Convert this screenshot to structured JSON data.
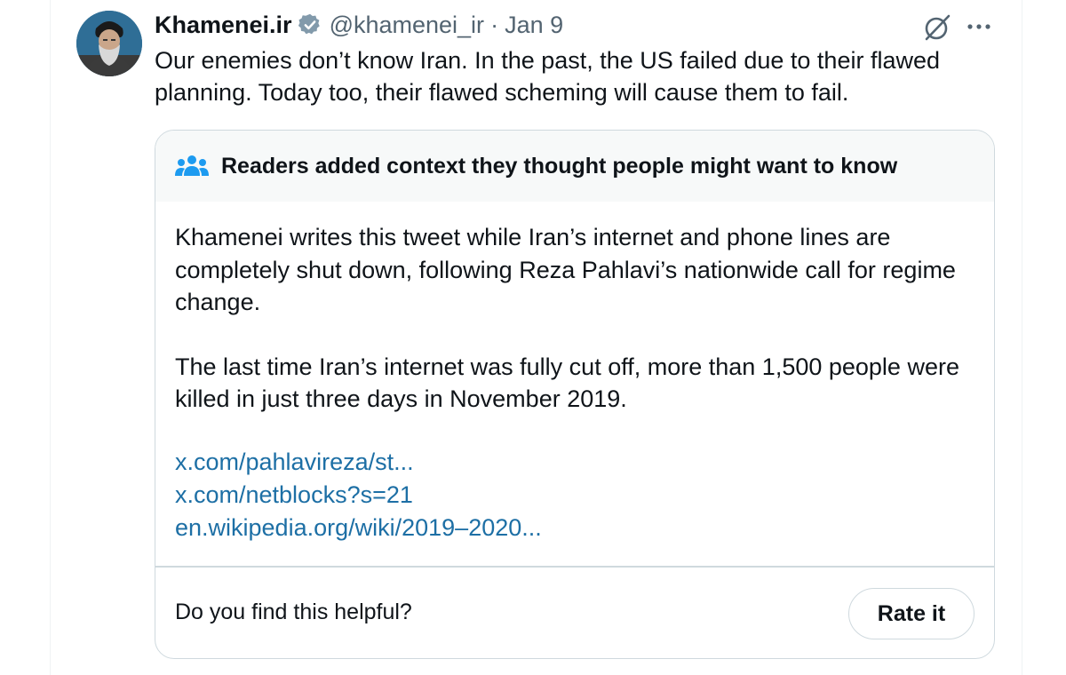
{
  "tweet": {
    "author": {
      "display_name": "Khamenei.ir",
      "handle": "@khamenei_ir",
      "verified": true,
      "avatar_icon": "user-avatar"
    },
    "separator": "·",
    "date": "Jan 9",
    "text": "Our enemies don’t know Iran. In the past, the US failed due to their flawed planning. Today too, their flawed scheming will cause them to fail.",
    "icons": {
      "grok": "grok-icon",
      "more": "more-options-icon"
    }
  },
  "community_note": {
    "title": "Readers added context they thought people might want to know",
    "header_icon": "people-icon",
    "paragraphs": [
      "Khamenei writes this tweet while Iran’s internet and phone lines are completely shut down, following Reza Pahlavi’s nationwide call for regime change.",
      "The last time Iran’s internet was fully cut off, more than 1,500 people were killed in just three days in November 2019."
    ],
    "links": [
      "x.com/pahlavireza/st...",
      "x.com/netblocks?s=21",
      "en.wikipedia.org/wiki/2019–2020..."
    ],
    "helpful_question": "Do you find this helpful?",
    "rate_button_label": "Rate it"
  },
  "colors": {
    "text_primary": "#0f1419",
    "text_secondary": "#536471",
    "link": "#1d6fa5",
    "note_header_bg": "#f7f9f9",
    "border": "#cfd9de",
    "verified_badge": "#829aab"
  }
}
